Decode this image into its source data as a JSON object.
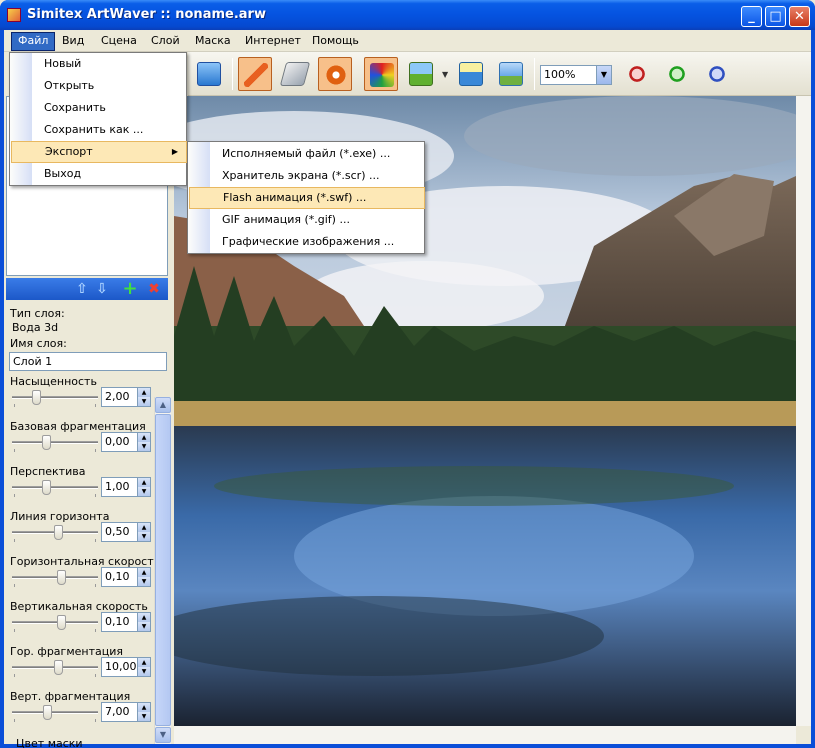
{
  "window": {
    "title": "Simitex ArtWaver :: noname.arw",
    "minimize_glyph": "_",
    "maximize_glyph": "□",
    "close_glyph": "✕"
  },
  "menubar": [
    "Файл",
    "Вид",
    "Сцена",
    "Слой",
    "Маска",
    "Интернет",
    "Помощь"
  ],
  "file_menu": {
    "items": [
      "Новый",
      "Открыть",
      "Сохранить",
      "Сохранить как ...",
      "Экспорт",
      "Выход"
    ],
    "submenu_arrow": "▶"
  },
  "export_submenu": {
    "items": [
      "Исполняемый файл (*.exe) ...",
      "Хранитель экрана (*.scr) ...",
      "Flash анимация (*.swf) ...",
      "GIF анимация (*.gif) ...",
      "Графические изображения ..."
    ]
  },
  "toolbar": {
    "zoom": "100%",
    "combo_arrow": "▼",
    "dropdown_arrow": "▼",
    "icons": [
      "image-icon",
      "brush-icon",
      "eraser-icon",
      "settings-icon",
      "palette-icon",
      "landscape-icon",
      "water-icon",
      "sky-icon",
      "wave-icon",
      "zoom-out-icon",
      "zoom-in-icon",
      "zoom-fit-icon"
    ]
  },
  "layer_panel": {
    "buttons": {
      "up": "⇧",
      "down": "⇩",
      "add": "+",
      "delete": "✖"
    }
  },
  "properties": {
    "layer_type_label": "Тип слоя:",
    "layer_type": "Вода 3d",
    "layer_name_label": "Имя слоя:",
    "layer_name": "Слой 1",
    "params": [
      {
        "label": "Насыщенность",
        "value": "2,00",
        "level": 0.25
      },
      {
        "label": "Базовая фрагментация",
        "value": "0,00",
        "level": 0.38
      },
      {
        "label": "Перспектива",
        "value": "1,00",
        "level": 0.38
      },
      {
        "label": "Линия горизонта",
        "value": "0,50",
        "level": 0.52
      },
      {
        "label": "Горизонтальная скорость",
        "value": "0,10",
        "level": 0.56
      },
      {
        "label": "Вертикальная скорость",
        "value": "0,10",
        "level": 0.56
      },
      {
        "label": "Гор. фрагментация",
        "value": "10,00",
        "level": 0.52
      },
      {
        "label": "Верт. фрагментация",
        "value": "7,00",
        "level": 0.39
      }
    ],
    "spin_up": "▲",
    "spin_down": "▼",
    "mask_color_label": "Цвет маски",
    "scroll_up": "▲",
    "scroll_down": "▼"
  },
  "colors": {
    "title_bar": "#0553e0",
    "menu_highlight": "#fde8b6",
    "selected_menu": "#316ac5"
  }
}
